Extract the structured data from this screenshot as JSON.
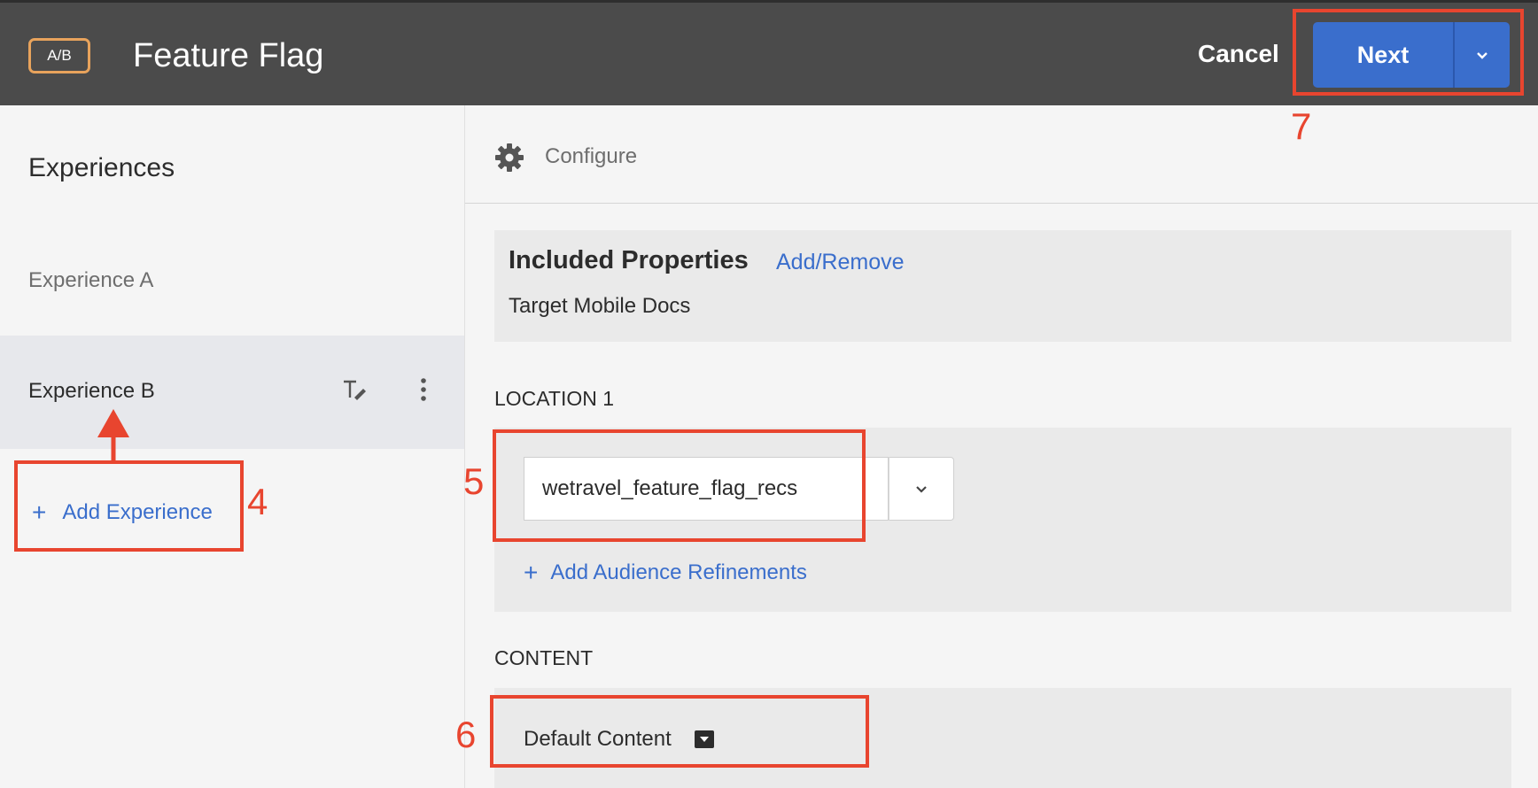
{
  "header": {
    "badge": "A/B",
    "title": "Feature Flag",
    "cancel_label": "Cancel",
    "next_label": "Next"
  },
  "sidebar": {
    "title": "Experiences",
    "experiences": [
      {
        "label": "Experience A"
      },
      {
        "label": "Experience B"
      }
    ],
    "add_experience_label": "Add Experience"
  },
  "main": {
    "configure_label": "Configure",
    "included_properties": {
      "title": "Included Properties",
      "action_label": "Add/Remove",
      "value": "Target Mobile Docs"
    },
    "location": {
      "label": "LOCATION 1",
      "value": "wetravel_feature_flag_recs",
      "add_refinements_label": "Add Audience Refinements"
    },
    "content": {
      "label": "CONTENT",
      "value": "Default Content"
    }
  },
  "annotations": [
    "4",
    "5",
    "6",
    "7"
  ],
  "colors": {
    "header_bg": "#4b4b4b",
    "accent": "#3a6ecc",
    "annotation": "#e8452f",
    "badge_border": "#e8a35c"
  }
}
